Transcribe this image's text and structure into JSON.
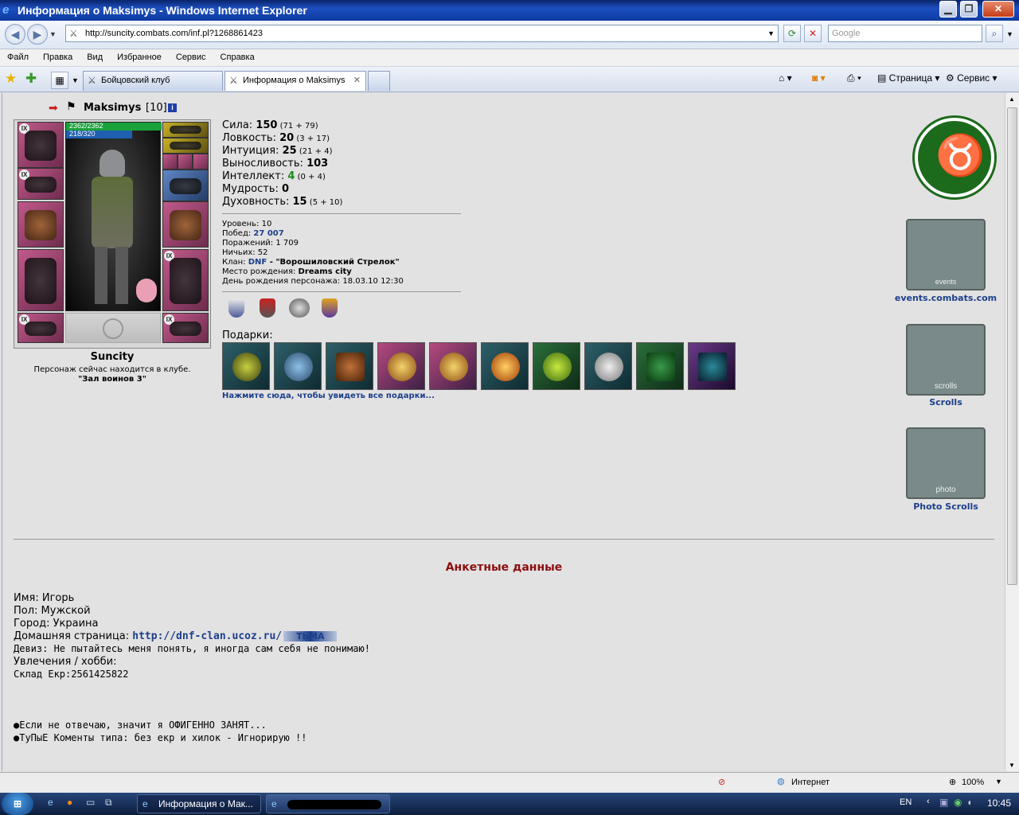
{
  "window": {
    "title": "Информация о Maksimys - Windows Internet Explorer"
  },
  "address": {
    "url": "http://suncity.combats.com/inf.pl?1268861423",
    "search_placeholder": "Google"
  },
  "menu": [
    "Файл",
    "Правка",
    "Вид",
    "Избранное",
    "Сервис",
    "Справка"
  ],
  "tabs": [
    {
      "label": "Бойцовский клуб"
    },
    {
      "label": "Информация о Maksimys"
    }
  ],
  "toolbar": {
    "page": "Страница",
    "service": "Сервис"
  },
  "character": {
    "name": "Maksimys",
    "level": "[10]",
    "hp": "2362/2362",
    "mana": "218/320",
    "city": "Suncity",
    "location_text": "Персонаж сейчас находится в клубе.",
    "location": "\"Зал воинов 3\""
  },
  "stats": [
    {
      "label": "Сила: ",
      "value": "150",
      "extra": " (71 + 79)"
    },
    {
      "label": "Ловкость: ",
      "value": "20",
      "extra": " (3 + 17)"
    },
    {
      "label": "Интуиция: ",
      "value": "25",
      "extra": " (21 + 4)"
    },
    {
      "label": "Выносливость: ",
      "value": "103",
      "extra": ""
    },
    {
      "label": "Интеллект: ",
      "value": "4",
      "extra": " (0 + 4)"
    },
    {
      "label": "Мудрость: ",
      "value": "0",
      "extra": ""
    },
    {
      "label": "Духовность: ",
      "value": "15",
      "extra": " (5 + 10)"
    }
  ],
  "info": {
    "level_label": "Уровень: ",
    "level": "10",
    "wins_label": "Побед: ",
    "wins": "27 007",
    "losses_label": "Поражений: ",
    "losses": "1 709",
    "draws_label": "Ничьих: ",
    "draws": "52",
    "clan_label": "Клан: ",
    "clan": "DNF",
    "clan_name": " - \"Ворошиловский Стрелок\"",
    "birthplace_label": "Место рождения: ",
    "birthplace": "Dreams city",
    "birthday_label": "День рождения персонажа: ",
    "birthday": "18.03.10 12:30"
  },
  "gifts": {
    "label": "Подарки:",
    "link": "Нажмите сюда, чтобы увидеть все подарки..."
  },
  "sidebar": {
    "events": "events.combats.com",
    "scrolls": "Scrolls",
    "photo": "Photo Scrolls",
    "banner_events": "events",
    "banner_scrolls": "scrolls",
    "banner_photo": "photo"
  },
  "profile": {
    "title": "Анкетные данные",
    "name": "Имя: Игорь",
    "sex": "Пол: Мужской",
    "city": "Город: Украина",
    "homepage_label": "Домашняя страница: ",
    "homepage": "http://dnf-clan.ucoz.ru/",
    "homepage_deco": "ТЬМА",
    "motto": "Девиз: Не пытайтесь меня понять, я иногда сам себя не понимаю!",
    "hobby": "Увлечения / хобби:",
    "line1": "Склад Екр:2561425822",
    "line2": "●Если не отвечаю, значит я ОФИГЕННО ЗАНЯТ...",
    "line3": "●ТуПыЕ Коменты типа: без екр и хилок - Игнорирую !!"
  },
  "status": {
    "zone": "Интернет",
    "zoom": "100%"
  },
  "taskbar": {
    "task1": "Информация о Мак...",
    "lang": "EN",
    "time": "10:45"
  },
  "colors": {
    "title_red": "#8b0f0f",
    "link_blue": "#1c3f8c",
    "hp_green": "#1aa23a",
    "mana_blue": "#1e5fb0"
  }
}
